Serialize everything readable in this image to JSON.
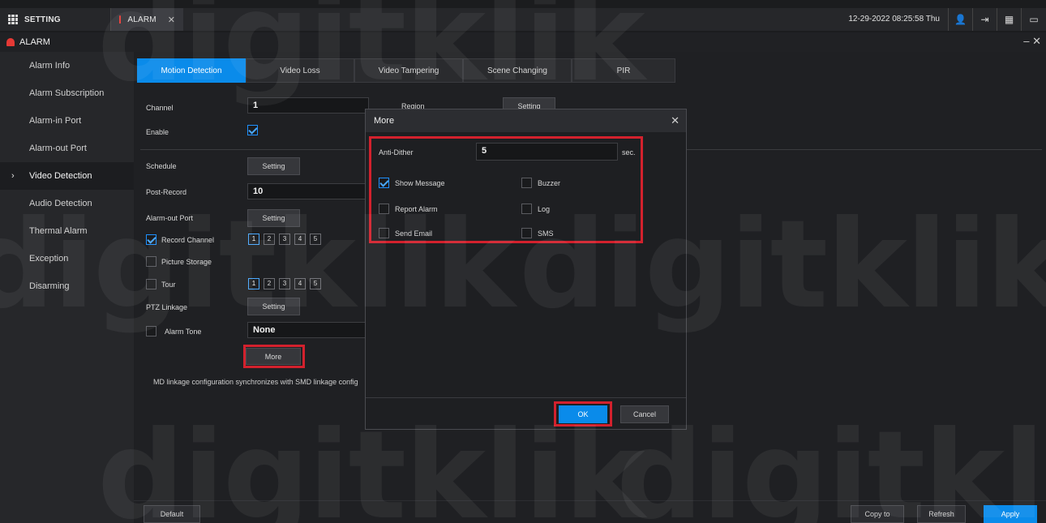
{
  "topbar": {
    "setting_tab": "SETTING",
    "alarm_tab": "ALARM",
    "datetime": "12-29-2022 08:25:58 Thu"
  },
  "titlebar": {
    "title": "ALARM"
  },
  "sidebar": {
    "items": [
      {
        "label": "Alarm Info"
      },
      {
        "label": "Alarm Subscription"
      },
      {
        "label": "Alarm-in Port"
      },
      {
        "label": "Alarm-out Port"
      },
      {
        "label": "Video Detection"
      },
      {
        "label": "Audio Detection"
      },
      {
        "label": "Thermal Alarm"
      },
      {
        "label": "Exception"
      },
      {
        "label": "Disarming"
      }
    ]
  },
  "tabs": [
    {
      "label": "Motion Detection"
    },
    {
      "label": "Video Loss"
    },
    {
      "label": "Video Tampering"
    },
    {
      "label": "Scene Changing"
    },
    {
      "label": "PIR"
    }
  ],
  "form": {
    "channel_label": "Channel",
    "channel_value": "1",
    "region_label": "Region",
    "region_button": "Setting",
    "enable_label": "Enable",
    "schedule_label": "Schedule",
    "schedule_button": "Setting",
    "post_record_label": "Post-Record",
    "post_record_value": "10",
    "alarm_out_label": "Alarm-out Port",
    "alarm_out_button": "Setting",
    "record_channel_label": "Record Channel",
    "record_channels": [
      "1",
      "2",
      "3",
      "4",
      "5"
    ],
    "picture_storage_label": "Picture Storage",
    "tour_label": "Tour",
    "tour_channels": [
      "1",
      "2",
      "3",
      "4",
      "5"
    ],
    "ptz_label": "PTZ Linkage",
    "ptz_button": "Setting",
    "alarm_tone_label": "Alarm Tone",
    "alarm_tone_value": "None",
    "more_button": "More",
    "note": "MD linkage configuration synchronizes with SMD linkage config"
  },
  "dialog": {
    "title": "More",
    "anti_dither_label": "Anti-Dither",
    "anti_dither_value": "5",
    "anti_dither_unit": "sec.",
    "show_message": "Show Message",
    "buzzer": "Buzzer",
    "report_alarm": "Report Alarm",
    "log": "Log",
    "send_email": "Send Email",
    "sms": "SMS",
    "ok": "OK",
    "cancel": "Cancel"
  },
  "bottom": {
    "default": "Default",
    "copy_to": "Copy to",
    "refresh": "Refresh",
    "apply": "Apply"
  },
  "watermark": "digitklik",
  "colors": {
    "accent": "#0a8bea",
    "highlight": "#d3212d"
  }
}
